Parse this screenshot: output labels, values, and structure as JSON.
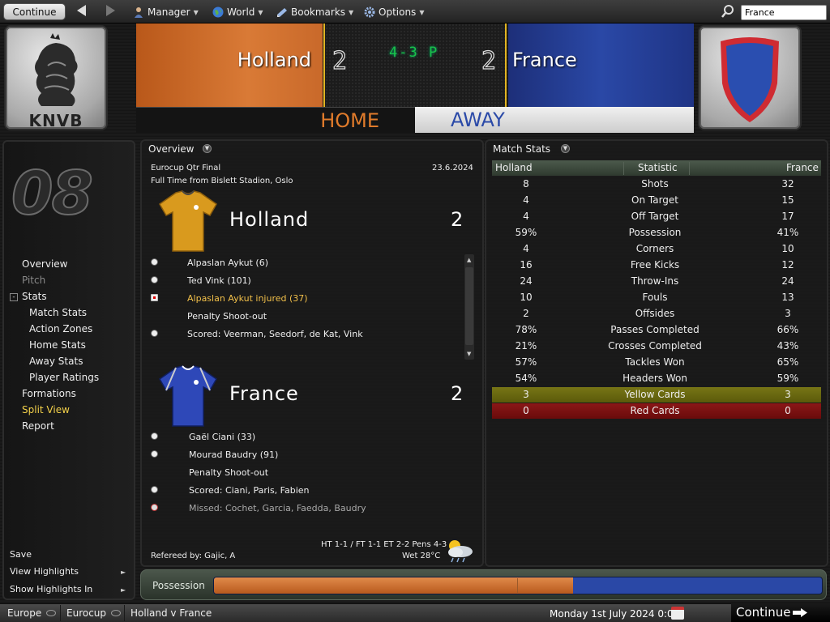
{
  "top": {
    "continue_label": "Continue",
    "menu": [
      {
        "label": "Manager",
        "icon": "manager-icon"
      },
      {
        "label": "World",
        "icon": "globe-icon"
      },
      {
        "label": "Bookmarks",
        "icon": "bookmarks-icon"
      },
      {
        "label": "Options",
        "icon": "gear-icon"
      }
    ],
    "search_value": "France"
  },
  "header": {
    "home_team": "Holland",
    "away_team": "France",
    "home_goals": "2",
    "away_goals": "2",
    "penalties": "4-3 P",
    "home_badge_text": "KNVB",
    "tab_home": "HOME",
    "tab_away": "AWAY"
  },
  "sidebar": {
    "logo": "08",
    "items": [
      "Overview",
      "Pitch",
      "Stats",
      "Match Stats",
      "Action Zones",
      "Home Stats",
      "Away Stats",
      "Player Ratings",
      "Formations",
      "Split View",
      "Report"
    ],
    "stats_toggle": "-",
    "save": "Save",
    "view_highlights": "View Highlights",
    "show_highlights_in": "Show Highlights In"
  },
  "overview": {
    "title": "Overview",
    "competition": "Eurocup Qtr Final",
    "date": "23.6.2024",
    "venue": "Full Time from Bislett Stadion, Oslo",
    "home": {
      "name": "Holland",
      "goals": "2",
      "events": [
        {
          "text": "Alpaslan Aykut (6)",
          "type": "goal"
        },
        {
          "text": "Ted Vink (101)",
          "type": "goal"
        },
        {
          "text": "Alpaslan Aykut injured (37)",
          "type": "injury"
        },
        {
          "text": "Penalty Shoot-out",
          "type": "none"
        },
        {
          "text": "Scored: Veerman, Seedorf, de Kat, Vink",
          "type": "goal"
        }
      ]
    },
    "away": {
      "name": "France",
      "goals": "2",
      "events": [
        {
          "text": "Gaël Ciani (33)",
          "type": "goal"
        },
        {
          "text": "Mourad Baudry (91)",
          "type": "goal"
        },
        {
          "text": "Penalty Shoot-out",
          "type": "none"
        },
        {
          "text": "Scored: Ciani, Paris, Fabien",
          "type": "goal"
        },
        {
          "text": "Missed: Cochet, Garcia, Faedda, Baudry",
          "type": "miss"
        }
      ]
    },
    "referee": "Refereed by: Gajic, A",
    "scoreline": "HT 1-1 / FT 1-1 ET 2-2 Pens 4-3",
    "weather": "Wet 28°C"
  },
  "match_stats": {
    "title": "Match Stats",
    "headers": {
      "home": "Holland",
      "stat": "Statistic",
      "away": "France"
    },
    "rows": [
      {
        "home": "8",
        "stat": "Shots",
        "away": "32"
      },
      {
        "home": "4",
        "stat": "On Target",
        "away": "15"
      },
      {
        "home": "4",
        "stat": "Off Target",
        "away": "17"
      },
      {
        "home": "59%",
        "stat": "Possession",
        "away": "41%"
      },
      {
        "home": "4",
        "stat": "Corners",
        "away": "10"
      },
      {
        "home": "16",
        "stat": "Free Kicks",
        "away": "12"
      },
      {
        "home": "24",
        "stat": "Throw-Ins",
        "away": "24"
      },
      {
        "home": "10",
        "stat": "Fouls",
        "away": "13"
      },
      {
        "home": "2",
        "stat": "Offsides",
        "away": "3"
      },
      {
        "home": "78%",
        "stat": "Passes Completed",
        "away": "66%"
      },
      {
        "home": "21%",
        "stat": "Crosses Completed",
        "away": "43%"
      },
      {
        "home": "57%",
        "stat": "Tackles Won",
        "away": "65%"
      },
      {
        "home": "54%",
        "stat": "Headers Won",
        "away": "59%"
      },
      {
        "home": "3",
        "stat": "Yellow Cards",
        "away": "3"
      },
      {
        "home": "0",
        "stat": "Red Cards",
        "away": "0"
      }
    ]
  },
  "possession": {
    "label": "Possession",
    "home_pct": 59
  },
  "bottom": {
    "crumbs": [
      "Europe",
      "Eurocup",
      "Holland v France"
    ],
    "date": "Monday 1st July 2024 0:00",
    "continue_label": "Continue"
  },
  "colors": {
    "home": "#d97a36",
    "away": "#2a48a6",
    "active": "#f2d04a",
    "yellow_row": "#6b6a10",
    "red_row": "#7a1010"
  }
}
